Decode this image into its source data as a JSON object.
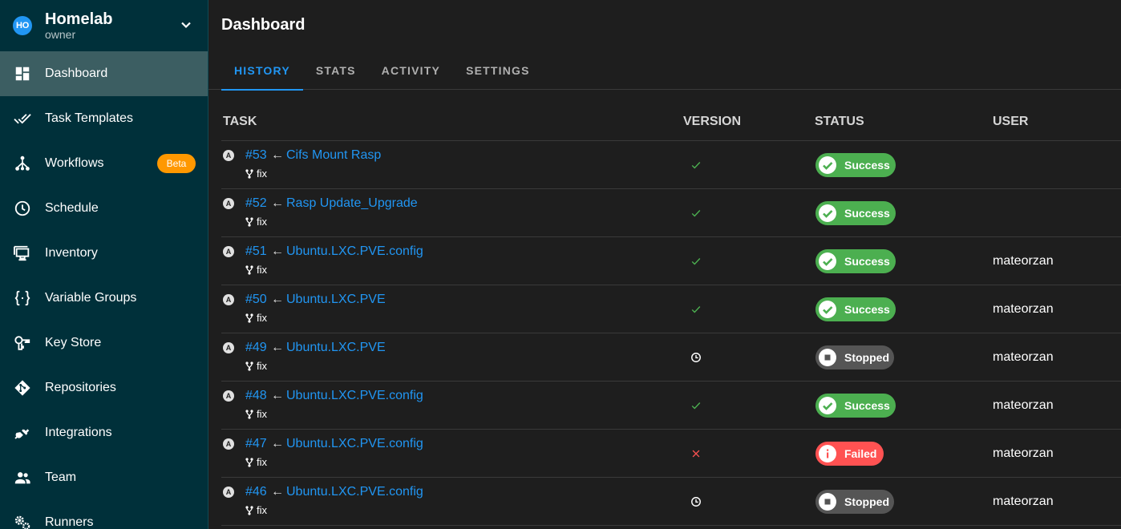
{
  "project": {
    "avatar": "HO",
    "name": "Homelab",
    "role": "owner"
  },
  "sidebar": {
    "items": [
      {
        "label": "Dashboard",
        "icon": "dashboard-icon",
        "active": true
      },
      {
        "label": "Task Templates",
        "icon": "double-check-icon"
      },
      {
        "label": "Workflows",
        "icon": "workflow-icon",
        "badge": "Beta"
      },
      {
        "label": "Schedule",
        "icon": "clock-icon"
      },
      {
        "label": "Inventory",
        "icon": "monitor-icon"
      },
      {
        "label": "Variable Groups",
        "icon": "braces-icon"
      },
      {
        "label": "Key Store",
        "icon": "key-icon"
      },
      {
        "label": "Repositories",
        "icon": "git-icon"
      },
      {
        "label": "Integrations",
        "icon": "plug-icon"
      },
      {
        "label": "Team",
        "icon": "team-icon"
      },
      {
        "label": "Runners",
        "icon": "cogs-icon"
      }
    ]
  },
  "page": {
    "title": "Dashboard"
  },
  "tabs": [
    {
      "label": "HISTORY",
      "active": true
    },
    {
      "label": "STATS"
    },
    {
      "label": "ACTIVITY"
    },
    {
      "label": "SETTINGS"
    }
  ],
  "table": {
    "headers": {
      "task": "TASK",
      "version": "VERSION",
      "status": "STATUS",
      "user": "USER"
    },
    "rows": [
      {
        "id": "#53",
        "arrow": "←",
        "name": "Cifs Mount Rasp",
        "branch": "fix",
        "version": "check",
        "status": "Success",
        "user": ""
      },
      {
        "id": "#52",
        "arrow": "←",
        "name": "Rasp Update_Upgrade",
        "branch": "fix",
        "version": "check",
        "status": "Success",
        "user": ""
      },
      {
        "id": "#51",
        "arrow": "←",
        "name": "Ubuntu.LXC.PVE.config",
        "branch": "fix",
        "version": "check",
        "status": "Success",
        "user": "mateorzan"
      },
      {
        "id": "#50",
        "arrow": "←",
        "name": "Ubuntu.LXC.PVE",
        "branch": "fix",
        "version": "check",
        "status": "Success",
        "user": "mateorzan"
      },
      {
        "id": "#49",
        "arrow": "←",
        "name": "Ubuntu.LXC.PVE",
        "branch": "fix",
        "version": "clock",
        "status": "Stopped",
        "user": "mateorzan"
      },
      {
        "id": "#48",
        "arrow": "←",
        "name": "Ubuntu.LXC.PVE.config",
        "branch": "fix",
        "version": "check",
        "status": "Success",
        "user": "mateorzan"
      },
      {
        "id": "#47",
        "arrow": "←",
        "name": "Ubuntu.LXC.PVE.config",
        "branch": "fix",
        "version": "cross",
        "status": "Failed",
        "user": "mateorzan"
      },
      {
        "id": "#46",
        "arrow": "←",
        "name": "Ubuntu.LXC.PVE.config",
        "branch": "fix",
        "version": "clock",
        "status": "Stopped",
        "user": "mateorzan"
      }
    ],
    "ansible_marker": "A"
  },
  "colors": {
    "sidebar_bg": "#00303a",
    "accent": "#2196f3",
    "success": "#4caf50",
    "failed": "#ff5252",
    "stopped": "#555555",
    "beta": "#ff9800"
  }
}
